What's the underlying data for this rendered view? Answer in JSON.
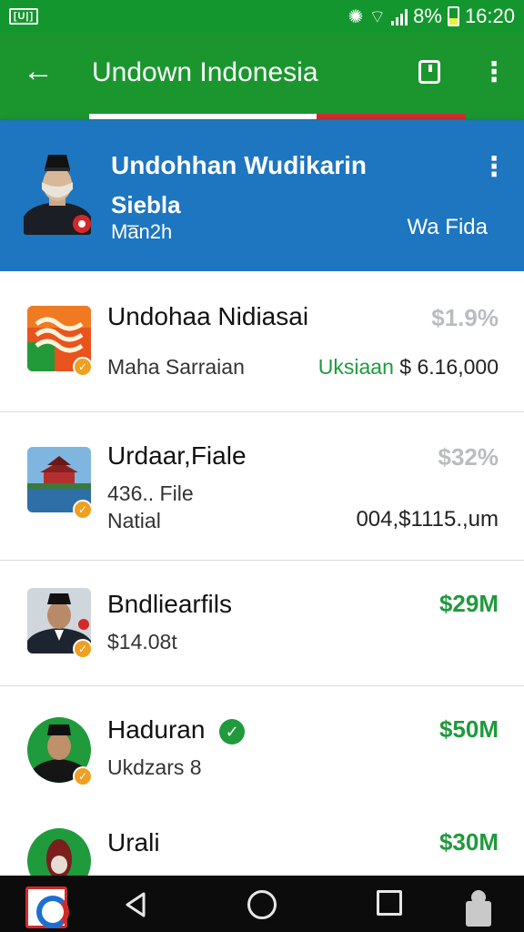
{
  "status_bar": {
    "sim_label": "[U|]",
    "battery_percent": "8%",
    "time": "16:20"
  },
  "app_bar": {
    "title": "Undown Indonesia",
    "back_icon": "arrow-left-icon",
    "bookmark_icon": "bookmark-icon",
    "more_icon": "more-vert-icon"
  },
  "profile": {
    "name": "Undohhan Wudikarin",
    "subtitle": "Siebla",
    "subtitle2": "Ma̅n2h",
    "right_text": "Wa Fida"
  },
  "list": [
    {
      "title": "Undohaa Nidiasai",
      "subtitle": "Maha Sarraian",
      "percent": "$1.9%",
      "amount_label": "Uksiaan",
      "amount": "$ 6.16,000"
    },
    {
      "title": "Urdaar,Fiale",
      "subtitle": "436.. File",
      "subtitle2": "Natial",
      "percent": "$32%",
      "amount": "004,$1115.,um"
    },
    {
      "title": "Bndliearfils",
      "subtitle": "$14.08t",
      "amount": "$29M"
    },
    {
      "title": "Haduran",
      "subtitle": "Ukdzars 8",
      "amount": "$50M"
    },
    {
      "title": "Urali",
      "amount": "$30M"
    }
  ],
  "colors": {
    "app_bar": "#1b962f",
    "profile_bg": "#1e75c0",
    "accent_green": "#1f9a3c",
    "accent_red": "#c8302e",
    "muted_percent": "#b9bcc0"
  }
}
